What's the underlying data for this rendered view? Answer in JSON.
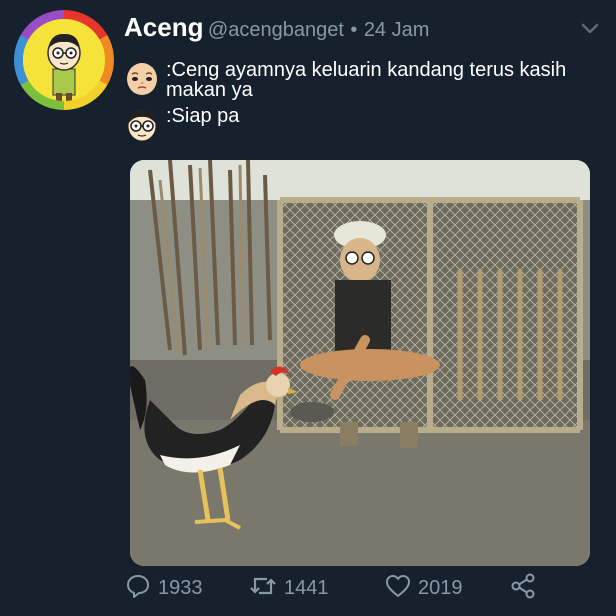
{
  "tweet": {
    "display_name": "Aceng",
    "handle": "@acengbanget",
    "separator": "•",
    "timestamp": "24 Jam",
    "messages": [
      {
        "speaker_icon": "baby-face-icon",
        "text": ":Ceng ayamnya keluarin kandang terus kasih makan ya"
      },
      {
        "speaker_icon": "glasses-face-icon",
        "text": ":Siap pa"
      }
    ],
    "stats": {
      "replies": "1933",
      "retweets": "1441",
      "likes": "2019"
    }
  },
  "icons": {
    "menu": "chevron-down-icon",
    "reply": "reply-icon",
    "retweet": "retweet-icon",
    "like": "heart-icon",
    "share": "share-icon"
  },
  "colors": {
    "background": "#17212e",
    "text_primary": "#ffffff",
    "text_secondary": "#8899a6"
  }
}
